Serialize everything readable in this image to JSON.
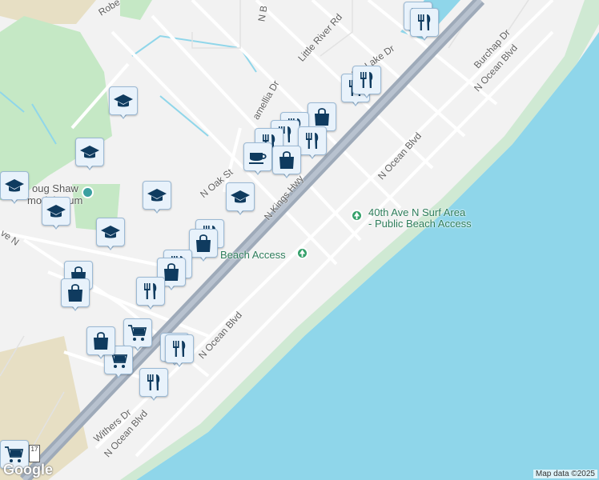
{
  "map": {
    "roads": [
      {
        "id": "robe",
        "label": "Robe"
      },
      {
        "id": "little-river",
        "label": "Little River Rd"
      },
      {
        "id": "pine-lake",
        "label": "Pine Lake Dr"
      },
      {
        "id": "burchap",
        "label": "Burchap Dr"
      },
      {
        "id": "n-ocean-1",
        "label": "N Ocean Blvd"
      },
      {
        "id": "n-ocean-2",
        "label": "N Ocean Blvd"
      },
      {
        "id": "n-ocean-3",
        "label": "N Ocean Blvd"
      },
      {
        "id": "n-ocean-4",
        "label": "N Ocean Blvd"
      },
      {
        "id": "n-kings",
        "label": "N Kings Hwy"
      },
      {
        "id": "n-oak",
        "label": "N Oak St"
      },
      {
        "id": "camellia",
        "label": "amellia Dr"
      },
      {
        "id": "withers",
        "label": "Withers Dr"
      },
      {
        "id": "ave-n",
        "label": "ve N"
      },
      {
        "id": "n-b",
        "label": "N B"
      }
    ],
    "pois": [
      {
        "id": "surf-area",
        "label": "40th Ave N Surf Area - Public Beach Access",
        "line1": "40th Ave N Surf Area",
        "line2": "- Public Beach Access"
      },
      {
        "id": "beach-access",
        "label": "Beach Access"
      },
      {
        "id": "doug-shaw",
        "line1": "oug Shaw",
        "line2": "morial S   um"
      }
    ],
    "markers": [
      {
        "type": "restaurant"
      },
      {
        "type": "restaurant"
      },
      {
        "type": "school"
      },
      {
        "type": "school"
      },
      {
        "type": "school"
      },
      {
        "type": "school"
      },
      {
        "type": "school"
      },
      {
        "type": "school"
      },
      {
        "type": "school"
      },
      {
        "type": "restaurant"
      },
      {
        "type": "restaurant"
      },
      {
        "type": "shopping"
      },
      {
        "type": "restaurant"
      },
      {
        "type": "restaurant"
      },
      {
        "type": "restaurant"
      },
      {
        "type": "restaurant"
      },
      {
        "type": "cafe"
      },
      {
        "type": "shopping"
      },
      {
        "type": "restaurant"
      },
      {
        "type": "shopping"
      },
      {
        "type": "restaurant"
      },
      {
        "type": "shopping"
      },
      {
        "type": "shopping"
      },
      {
        "type": "restaurant"
      },
      {
        "type": "shopping"
      },
      {
        "type": "grocery"
      },
      {
        "type": "grocery"
      },
      {
        "type": "shopping"
      },
      {
        "type": "restaurant"
      },
      {
        "type": "cafe"
      },
      {
        "type": "restaurant"
      },
      {
        "type": "grocery"
      }
    ],
    "highway_shield": "17",
    "attribution": "Map data ©2025",
    "logo": "Google",
    "colors": {
      "water": "#8fd6ea",
      "land": "#f2f2f2",
      "highway": "#9eaab9",
      "park": "#c5e8c5",
      "sand": "#e7dfc4",
      "marker_bg": "#e8f2fb",
      "marker_icon": "#0f3b5f",
      "poi_green": "#34a06a"
    }
  }
}
